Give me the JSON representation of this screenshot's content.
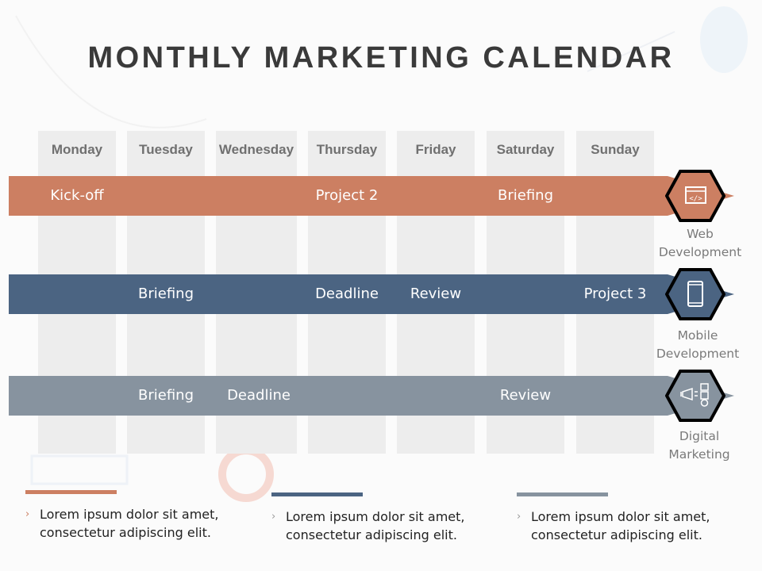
{
  "title": "MONTHLY MARKETING CALENDAR",
  "colors": {
    "web": "#cc7f62",
    "mobile": "#4b6482",
    "digital": "#87939f",
    "column_bg": "#ededed",
    "title": "#3a3a3a"
  },
  "days": [
    "Monday",
    "Tuesday",
    "Wednesday",
    "Thursday",
    "Friday",
    "Saturday",
    "Sunday"
  ],
  "rows": [
    {
      "category": "Web Development",
      "label_line1": "Web",
      "label_line2": "Development",
      "icon": "code-window-icon",
      "events": [
        {
          "day": "Monday",
          "text": "Kick-off"
        },
        {
          "day": "Thursday",
          "text": "Project 2"
        },
        {
          "day": "Saturday",
          "text": "Briefing"
        }
      ]
    },
    {
      "category": "Mobile Development",
      "label_line1": "Mobile",
      "label_line2": "Development",
      "icon": "smartphone-icon",
      "events": [
        {
          "day": "Tuesday",
          "text": "Briefing"
        },
        {
          "day": "Thursday",
          "text": "Deadline"
        },
        {
          "day": "Friday",
          "text": "Review"
        },
        {
          "day": "Sunday",
          "text": "Project 3"
        }
      ]
    },
    {
      "category": "Digital Marketing",
      "label_line1": "Digital",
      "label_line2": "Marketing",
      "icon": "megaphone-icon",
      "events": [
        {
          "day": "Tuesday",
          "text": "Briefing"
        },
        {
          "day": "Wednesday",
          "text": "Deadline"
        },
        {
          "day": "Saturday",
          "text": "Review"
        }
      ]
    }
  ],
  "notes": [
    {
      "line1": "Lorem ipsum dolor sit amet,",
      "line2": "consectetur adipiscing elit."
    },
    {
      "line1": "Lorem ipsum dolor sit amet,",
      "line2": "consectetur adipiscing elit."
    },
    {
      "line1": "Lorem ipsum dolor sit amet,",
      "line2": "consectetur adipiscing elit."
    }
  ],
  "bullet_glyph": "›"
}
